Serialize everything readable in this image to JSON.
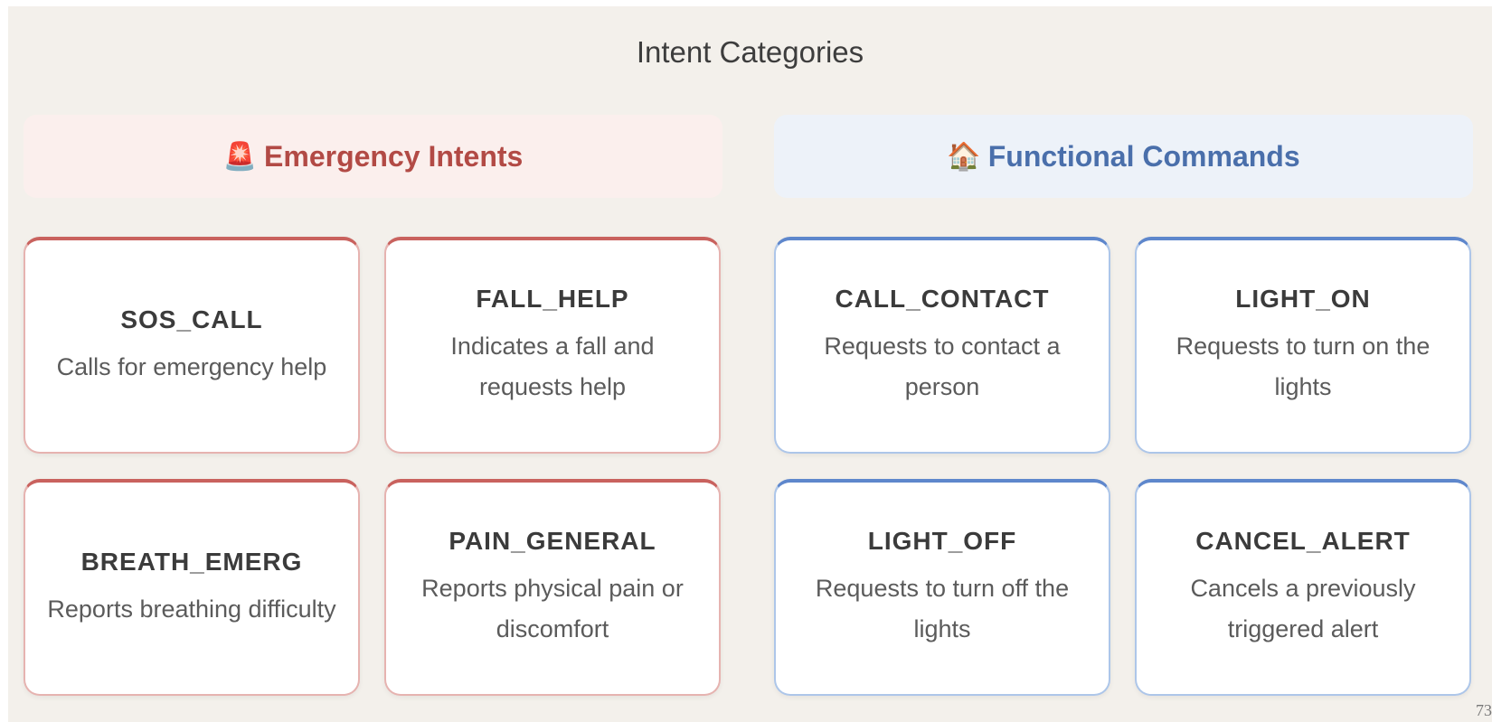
{
  "title": "Intent Categories",
  "groups": [
    {
      "icon": "🚨",
      "icon_name": "siren-icon",
      "label": "Emergency Intents",
      "color": "#b24a45",
      "cards": [
        {
          "name": "SOS_CALL",
          "description": "Calls for emergency help"
        },
        {
          "name": "FALL_HELP",
          "description": "Indicates a fall and requests help"
        },
        {
          "name": "BREATH_EMERG",
          "description": "Reports breathing difficulty"
        },
        {
          "name": "PAIN_GENERAL",
          "description": "Reports physical pain or discomfort"
        }
      ]
    },
    {
      "icon": "🏠",
      "icon_name": "house-icon",
      "label": "Functional Commands",
      "color": "#4a6fab",
      "cards": [
        {
          "name": "CALL_CONTACT",
          "description": "Requests to contact a person"
        },
        {
          "name": "LIGHT_ON",
          "description": "Requests to turn on the lights"
        },
        {
          "name": "LIGHT_OFF",
          "description": "Requests to turn off the lights"
        },
        {
          "name": "CANCEL_ALERT",
          "description": "Cancels a previously triggered alert"
        }
      ]
    }
  ],
  "page_number": "73"
}
